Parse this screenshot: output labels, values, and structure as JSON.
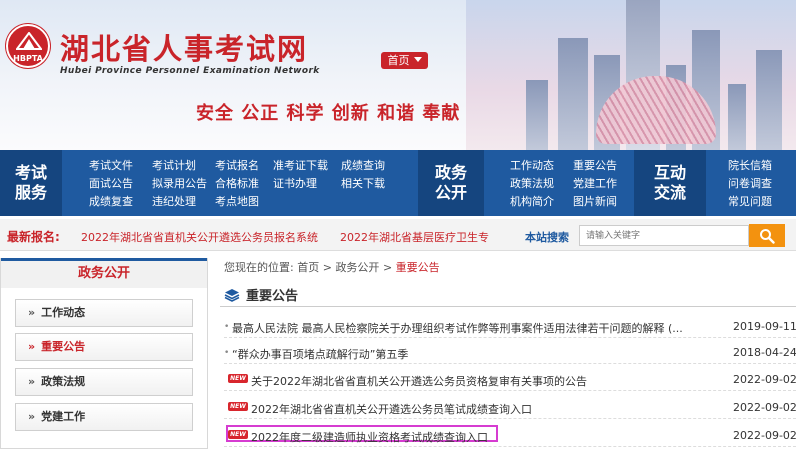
{
  "header": {
    "logo_text": "HBPTA",
    "site_title": "湖北省人事考试网",
    "site_title_en": "Hubei Province Personnel Examination Network",
    "home_button": "首页",
    "slogan": "安全 公正 科学 创新 和谐 奉献"
  },
  "nav": {
    "groups": [
      {
        "title_lines": [
          "考试",
          "服务"
        ],
        "links": [
          "考试文件",
          "考试计划",
          "考试报名",
          "准考证下载",
          "成绩查询",
          "面试公告",
          "拟录用公告",
          "合格标准",
          "证书办理",
          "相关下载",
          "成绩复查",
          "违纪处理",
          "考点地图"
        ]
      },
      {
        "title_lines": [
          "政务",
          "公开"
        ],
        "links": [
          "工作动态",
          "重要公告",
          "政策法规",
          "党建工作",
          "机构简介",
          "图片新闻"
        ]
      },
      {
        "title_lines": [
          "互动",
          "交流"
        ],
        "links": [
          "院长信箱",
          "问卷调查",
          "常见问题"
        ]
      }
    ]
  },
  "quick": {
    "label": "最新报名:",
    "items": [
      "2022年湖北省省直机关公开遴选公务员报名系统",
      "2022年湖北省基层医疗卫生专"
    ],
    "search_label": "本站搜索",
    "search_placeholder": "请输入关键字"
  },
  "sidebar": {
    "title": "政务公开",
    "items": [
      "工作动态",
      "重要公告",
      "政策法规",
      "党建工作"
    ],
    "active_index": 1
  },
  "main": {
    "breadcrumb_prefix": "您现在的位置:",
    "breadcrumb": [
      "首页",
      "政务公开",
      "重要公告"
    ],
    "section_title": "重要公告",
    "new_badge": "NEW",
    "rows": [
      {
        "title": "最高人民法院 最高人民检察院关于办理组织考试作弊等刑事案件适用法律若干问题的解释 (...",
        "date": "2019-09-11",
        "new": false,
        "highlight": false
      },
      {
        "title": "“群众办事百项堵点疏解行动”第五季",
        "date": "2018-04-24",
        "new": false,
        "highlight": false
      },
      {
        "title": "关于2022年湖北省省直机关公开遴选公务员资格复审有关事项的公告",
        "date": "2022-09-02",
        "new": true,
        "highlight": false
      },
      {
        "title": "2022年湖北省省直机关公开遴选公务员笔试成绩查询入口",
        "date": "2022-09-02",
        "new": true,
        "highlight": false
      },
      {
        "title": "2022年度二级建造师执业资格考试成绩查询入口",
        "date": "2022-09-02",
        "new": true,
        "highlight": true
      }
    ]
  },
  "colors": {
    "brand_red": "#c9242a",
    "nav_blue": "#1f5aa0",
    "search_orange": "#f3920f",
    "highlight": "#d63cd1"
  }
}
